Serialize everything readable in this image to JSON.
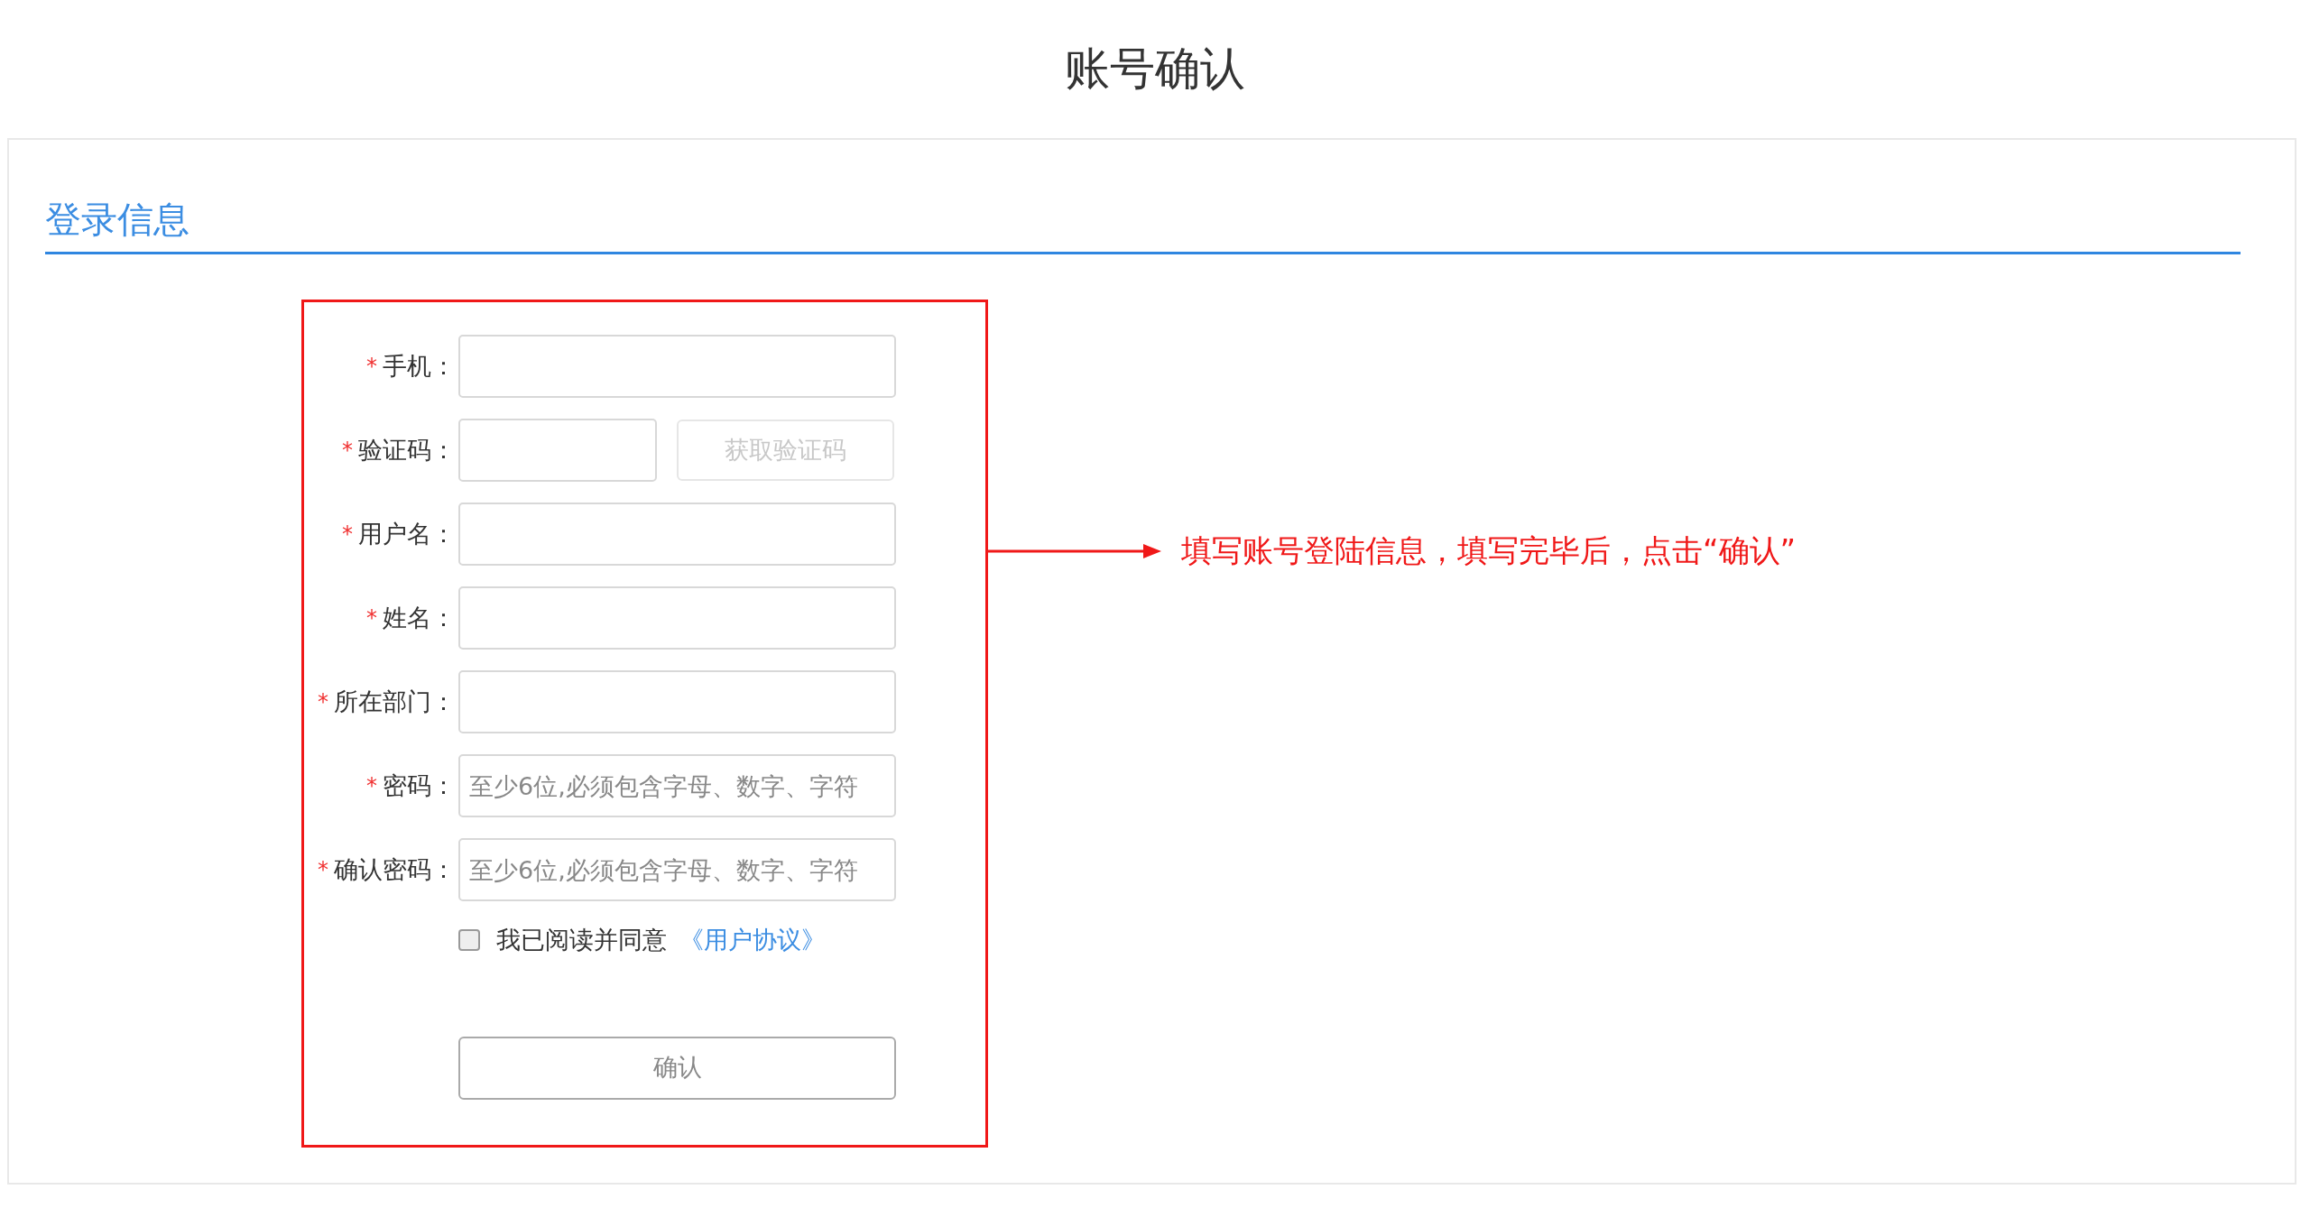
{
  "title": "账号确认",
  "section": {
    "heading": "登录信息"
  },
  "form": {
    "fields": [
      {
        "kind": "input",
        "mark": "*",
        "label": "手机："
      },
      {
        "kind": "code",
        "mark": "*",
        "label": "验证码：",
        "button": {
          "label": "获取验证码",
          "disabled": true
        }
      },
      {
        "kind": "input",
        "mark": "*",
        "label": "用户名："
      },
      {
        "kind": "input",
        "mark": "*",
        "label": "姓名："
      },
      {
        "kind": "input",
        "mark": "*",
        "label": "所在部门："
      },
      {
        "kind": "input",
        "mark": "*",
        "label": "密码：",
        "placeholder": "至少6位,必须包含字母、数字、字符"
      },
      {
        "kind": "input",
        "mark": "*",
        "label": "确认密码：",
        "placeholder": "至少6位,必须包含字母、数字、字符"
      }
    ],
    "agreement": {
      "checked": false,
      "text": "我已阅读并同意",
      "link": "《用户协议》"
    },
    "submit": {
      "label": "确认"
    }
  },
  "annotation": {
    "text": "填写账号登陆信息，填写完毕后，点击“确认”"
  }
}
